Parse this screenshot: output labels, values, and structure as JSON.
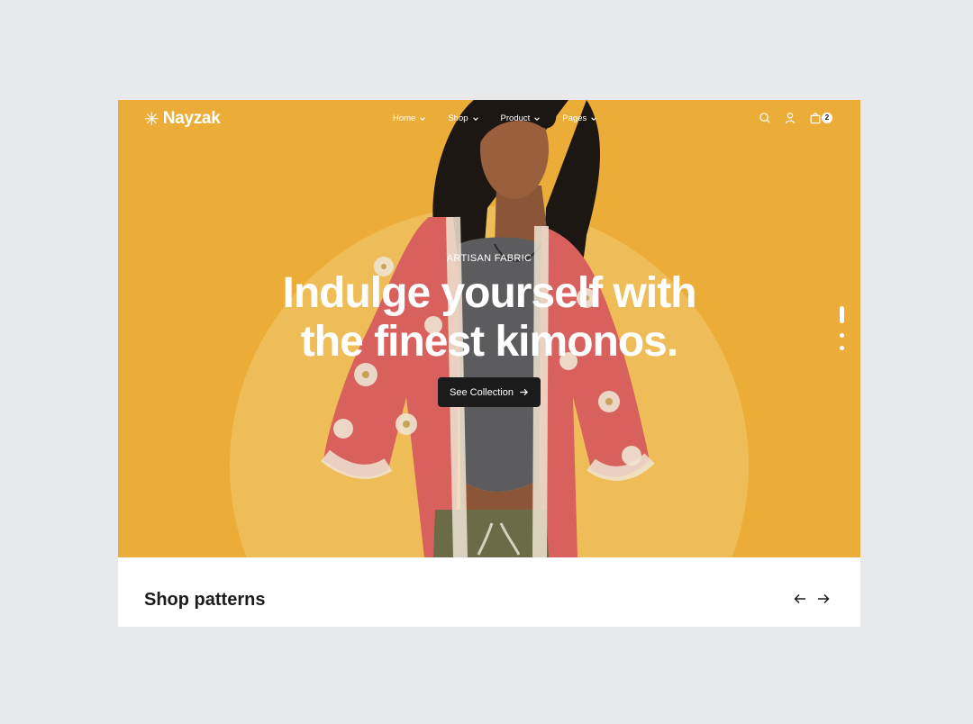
{
  "brand": {
    "name": "Nayzak",
    "mark_icon": "asterisk-icon"
  },
  "nav": {
    "items": [
      {
        "label": "Home"
      },
      {
        "label": "Shop"
      },
      {
        "label": "Product"
      },
      {
        "label": "Pages"
      }
    ]
  },
  "header_actions": {
    "cart_count": "2"
  },
  "hero": {
    "eyebrow": "ARTISAN FABRIC",
    "title_line1": "Indulge yourself with",
    "title_line2": "the finest kimonos.",
    "cta_label": "See Collection",
    "slide_count": 3,
    "active_slide": 1
  },
  "section": {
    "title": "Shop patterns"
  },
  "colors": {
    "hero_background": "#ecad38",
    "hero_circle": "#efbd57",
    "cta_background": "#1b1b1b",
    "page_background": "#e8e9eb",
    "kimono": "#d8615e"
  }
}
